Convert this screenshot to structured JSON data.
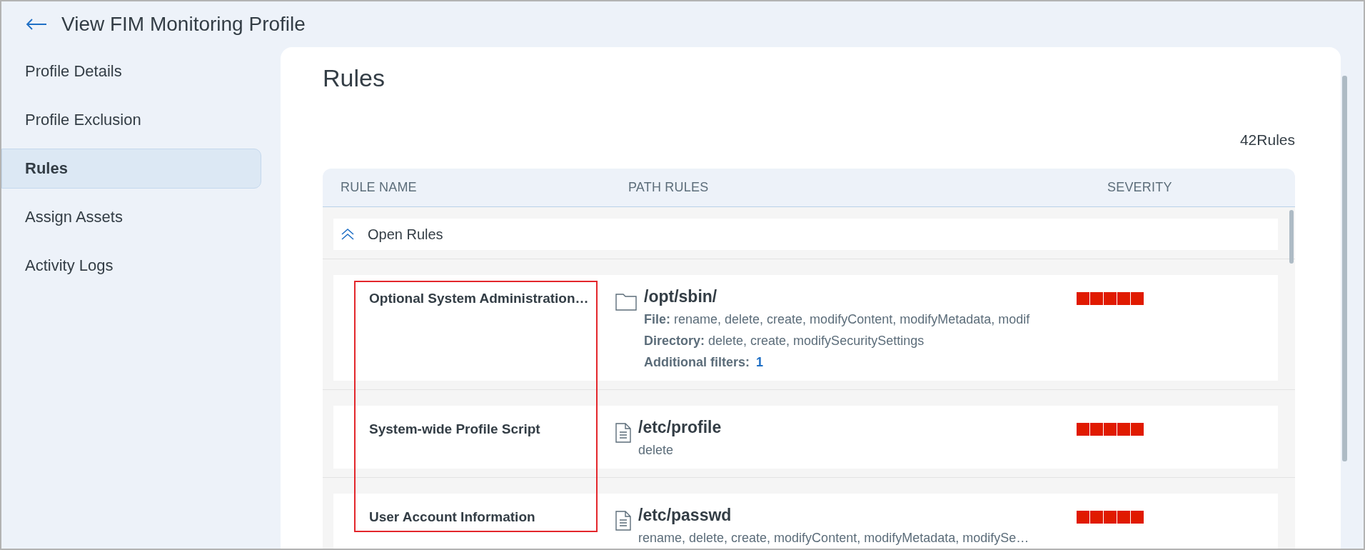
{
  "header": {
    "title": "View FIM Monitoring Profile"
  },
  "sidebar": {
    "items": [
      {
        "label": "Profile Details",
        "selected": false
      },
      {
        "label": "Profile Exclusion",
        "selected": false
      },
      {
        "label": "Rules",
        "selected": true
      },
      {
        "label": "Assign Assets",
        "selected": false
      },
      {
        "label": "Activity Logs",
        "selected": false
      }
    ]
  },
  "main": {
    "heading": "Rules",
    "count": "42Rules",
    "table": {
      "columns": [
        "RULE NAME",
        "PATH RULES",
        "SEVERITY"
      ],
      "group": {
        "label": "Open Rules",
        "expanded": true
      },
      "rows": [
        {
          "name": "Optional System Administration…",
          "kind": "folder",
          "path": "/opt/sbin/",
          "stars": 5,
          "lines": [
            {
              "kind": "actions",
              "label": "File:",
              "text": "rename, delete, create, modifyContent, modifyMetadata, modif"
            },
            {
              "kind": "actions",
              "label": "Directory:",
              "text": "delete, create, modifySecuritySettings"
            },
            {
              "kind": "count",
              "label": "Additional filters:",
              "text": "1"
            }
          ]
        },
        {
          "name": "System-wide Profile Script",
          "kind": "file",
          "path": "/etc/profile",
          "stars": 5,
          "lines": [
            {
              "kind": "actions",
              "text": "delete"
            }
          ]
        },
        {
          "name": "User Account Information",
          "kind": "file",
          "path": "/etc/passwd",
          "stars": 5,
          "lines": [
            {
              "kind": "actions",
              "text": "rename, delete, create, modifyContent, modifyMetadata, modifySe…"
            }
          ]
        }
      ]
    }
  }
}
